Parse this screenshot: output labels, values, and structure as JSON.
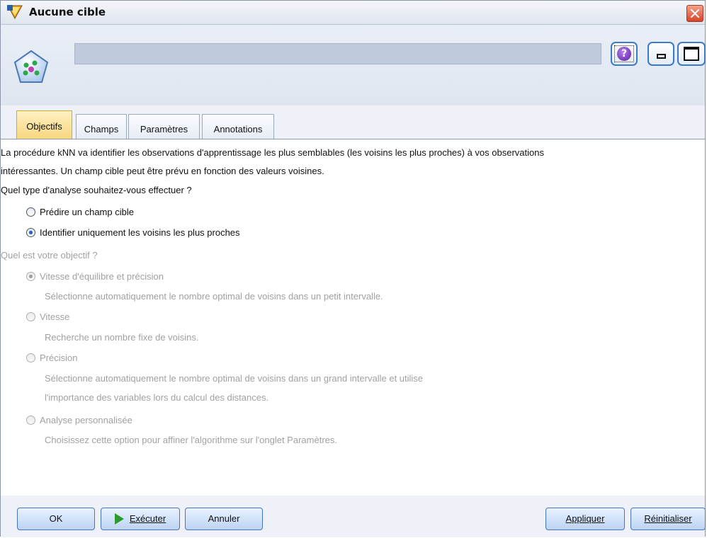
{
  "window": {
    "title": "Aucune cible"
  },
  "header": {
    "name_value": ""
  },
  "toolbar": {
    "help_glyph": "?"
  },
  "tabs": [
    {
      "label": "Objectifs"
    },
    {
      "label": "Champs"
    },
    {
      "label": "Paramètres"
    },
    {
      "label": "Annotations"
    }
  ],
  "intro": {
    "line1": "La procédure kNN va identifier les observations d'apprentissage les plus semblables (les voisins les plus proches) à vos observations",
    "line2": "intéressantes.  Un champ cible peut être prévu en fonction des valeurs voisines."
  },
  "analysis": {
    "question": "Quel type d'analyse souhaitez-vous effectuer ?",
    "options": [
      {
        "label": "Prédire un champ cible",
        "selected": false
      },
      {
        "label": "Identifier uniquement les voisins les plus proches",
        "selected": true
      }
    ]
  },
  "objective": {
    "question": "Quel est votre objectif ?",
    "options": [
      {
        "label": "Vitesse d'équilibre et précision",
        "selected": true,
        "desc": [
          "Sélectionne automatiquement le nombre optimal de voisins dans un petit intervalle."
        ]
      },
      {
        "label": "Vitesse",
        "selected": false,
        "desc": [
          "Recherche un nombre fixe de voisins."
        ]
      },
      {
        "label": "Précision",
        "selected": false,
        "desc": [
          "Sélectionne automatiquement le nombre optimal de voisins dans un grand intervalle et utilise",
          "l'importance des variables lors du calcul des distances."
        ]
      },
      {
        "label": "Analyse personnalisée",
        "selected": false,
        "desc": [
          "Choisissez cette option pour affiner l'algorithme sur l'onglet Paramètres."
        ]
      }
    ]
  },
  "buttons": {
    "ok": "OK",
    "run": "Exécuter",
    "cancel": "Annuler",
    "apply": "Appliquer",
    "reset": "Réinitialiser"
  },
  "colors": {
    "active_tab": "#f6d67d",
    "selected_radio": "#1f5fd1",
    "disabled_text": "#a1a1a1",
    "run_icon": "#2d9a2d",
    "close_button": "#d7432a"
  }
}
